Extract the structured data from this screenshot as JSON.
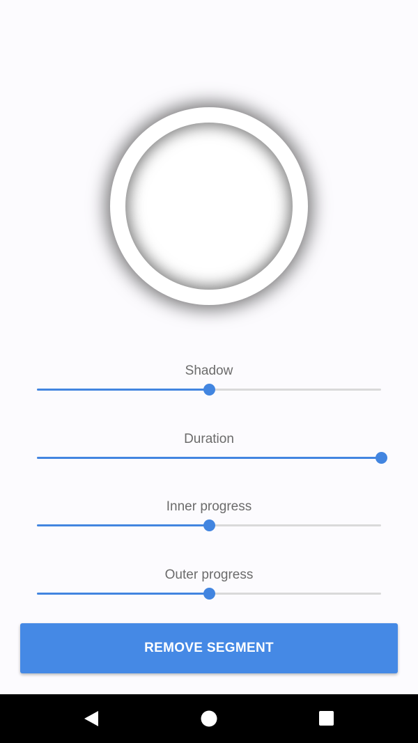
{
  "controls": [
    {
      "label": "Shadow",
      "value": 0.5
    },
    {
      "label": "Duration",
      "value": 1.0
    },
    {
      "label": "Inner progress",
      "value": 0.5
    },
    {
      "label": "Outer progress",
      "value": 0.5
    }
  ],
  "button": {
    "label": "REMOVE SEGMENT"
  },
  "nav": {
    "back_icon": "back-triangle-icon",
    "home_icon": "home-circle-icon",
    "recents_icon": "recents-square-icon"
  },
  "colors": {
    "accent": "#4285e0",
    "button": "#4589e5",
    "track": "#d9d9d9",
    "label": "#6b6b6b",
    "background": "#fcfbfe"
  }
}
